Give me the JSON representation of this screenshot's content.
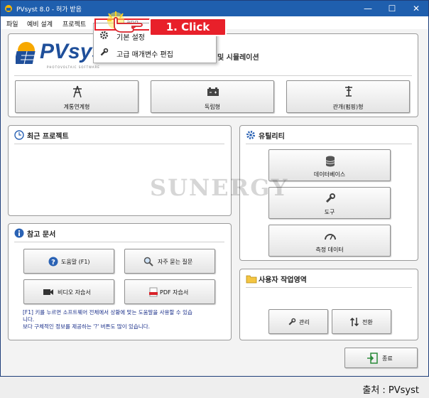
{
  "window": {
    "title": "PVsyst 8.0 - 허가 받음",
    "min_glyph": "—",
    "max_glyph": "☐",
    "close_glyph": "✕"
  },
  "menu": [
    "파일",
    "예비 설계",
    "프로젝트",
    "설정",
    "Lang"
  ],
  "dropdown": {
    "items": [
      {
        "label": "기본 설정",
        "icon": "gear-icon"
      },
      {
        "label": "고급 매개변수 편집",
        "icon": "wrench-icon"
      }
    ]
  },
  "callout": {
    "label": "1. Click",
    "color": "#e8202a"
  },
  "header": {
    "logo_text": "PVsyst",
    "logo_subtitle": "PHOTOVOLTAIC SOFTWARE",
    "subtitle_tail": "및 시뮬레이션"
  },
  "system_buttons": [
    {
      "label": "계통연계형",
      "icon": "grid-tower-icon"
    },
    {
      "label": "독립형",
      "icon": "battery-icon"
    },
    {
      "label": "관개(펌핑)형",
      "icon": "pump-icon"
    }
  ],
  "recent_projects": {
    "title": "최근 프로젝트",
    "icon": "clock-icon"
  },
  "utilities": {
    "title": "유틸리티",
    "icon": "gear-icon",
    "buttons": [
      {
        "label": "데이터베이스",
        "icon": "database-icon"
      },
      {
        "label": "도구",
        "icon": "wrench-icon"
      },
      {
        "label": "측정 데이터",
        "icon": "gauge-icon"
      }
    ]
  },
  "references": {
    "title": "참고 문서",
    "icon": "info-icon",
    "buttons": [
      {
        "label": "도움말 (F1)",
        "icon": "help-icon"
      },
      {
        "label": "자주 묻는 질문",
        "icon": "magnifier-icon"
      },
      {
        "label": "비디오 자습서",
        "icon": "video-camera-icon"
      },
      {
        "label": "PDF 자습서",
        "icon": "pdf-icon"
      }
    ],
    "note_line1": "[F1] 키를 누르면 소프트웨어 전체에서 상황에 맞는 도움말을 사용할 수 있습",
    "note_line2": "니다.",
    "note_line3": "보다 구체적인 정보를 제공하는 '?' 버튼도 많이 있습니다."
  },
  "workspace": {
    "title": "사용자 작업영역",
    "icon": "folder-icon",
    "buttons": [
      {
        "label": "관리",
        "icon": "wrench-icon"
      },
      {
        "label": "전환",
        "icon": "swap-arrows-icon"
      }
    ]
  },
  "exit_button": {
    "label": "종료",
    "icon": "exit-door-icon"
  },
  "watermark": "SUNERGY",
  "source_caption": "출처 : PVsyst"
}
